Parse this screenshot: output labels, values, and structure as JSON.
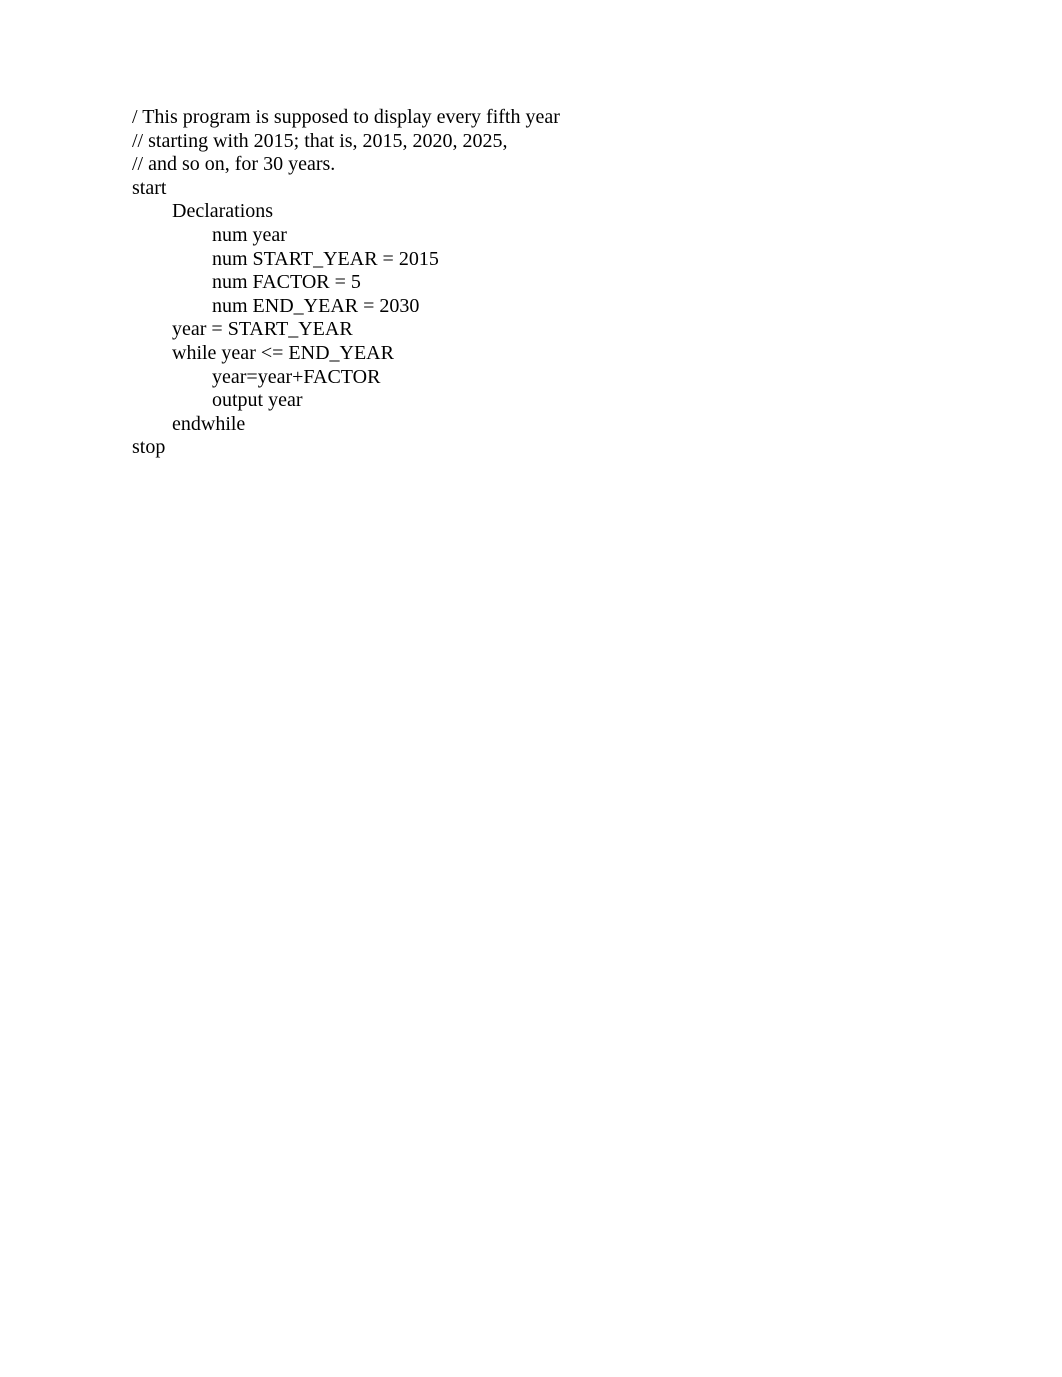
{
  "code": {
    "lines": [
      {
        "text": "/ This program is supposed to display every fifth year",
        "indent": 0
      },
      {
        "text": "// starting with 2015; that is, 2015, 2020, 2025,",
        "indent": 0
      },
      {
        "text": "// and so on, for 30 years.",
        "indent": 0
      },
      {
        "text": "start",
        "indent": 0
      },
      {
        "text": "Declarations",
        "indent": 1
      },
      {
        "text": "num year",
        "indent": 2
      },
      {
        "text": "num START_YEAR = 2015",
        "indent": 2
      },
      {
        "text": "num FACTOR = 5",
        "indent": 2
      },
      {
        "text": "num END_YEAR = 2030",
        "indent": 2
      },
      {
        "text": "year = START_YEAR",
        "indent": 1
      },
      {
        "text": "while year <= END_YEAR",
        "indent": 1
      },
      {
        "text": "year=year+FACTOR",
        "indent": 2
      },
      {
        "text": "output year",
        "indent": 2
      },
      {
        "text": "endwhile",
        "indent": 1
      },
      {
        "text": "stop",
        "indent": 0
      }
    ]
  }
}
